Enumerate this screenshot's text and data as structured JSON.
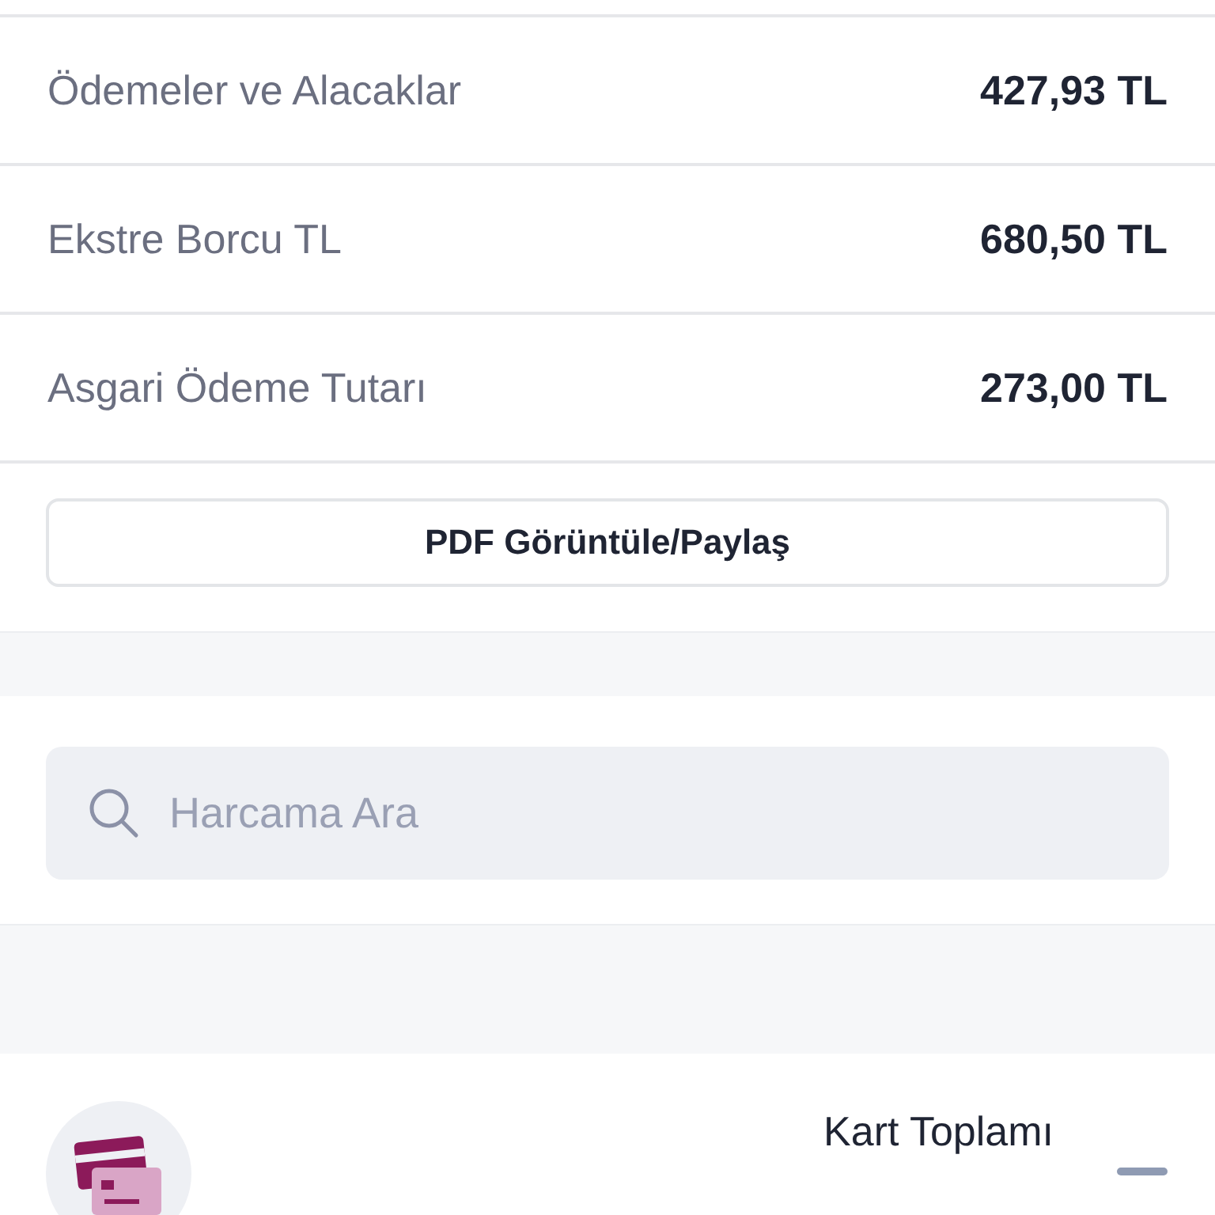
{
  "summary_rows": [
    {
      "label": "Ödemeler ve Alacaklar",
      "value": "427,93 TL"
    },
    {
      "label": "Ekstre Borcu TL",
      "value": "680,50 TL"
    },
    {
      "label": "Asgari Ödeme Tutarı",
      "value": "273,00 TL"
    }
  ],
  "pdf_button": "PDF Görüntüle/Paylaş",
  "search": {
    "placeholder": "Harcama Ara"
  },
  "card_total": {
    "label": "Kart Toplamı"
  }
}
